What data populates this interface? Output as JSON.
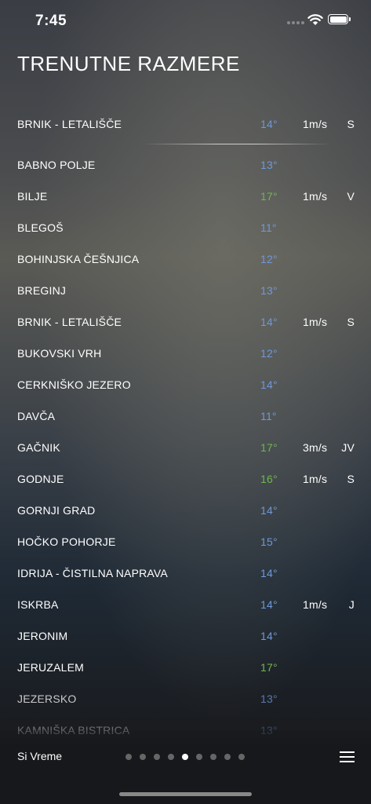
{
  "status": {
    "time": "7:45"
  },
  "title": "TRENUTNE RAZMERE",
  "featured": {
    "name": "BRNIK - LETALIŠČE",
    "temp": "14°",
    "wind": "1m/s",
    "dir": "S",
    "color": "blue"
  },
  "stations": [
    {
      "name": "BABNO POLJE",
      "temp": "13°",
      "wind": "",
      "dir": "",
      "color": "blue"
    },
    {
      "name": "BILJE",
      "temp": "17°",
      "wind": "1m/s",
      "dir": "V",
      "color": "green"
    },
    {
      "name": "BLEGOŠ",
      "temp": "11°",
      "wind": "",
      "dir": "",
      "color": "blue"
    },
    {
      "name": "BOHINJSKA ČEŠNJICA",
      "temp": "12°",
      "wind": "",
      "dir": "",
      "color": "blue"
    },
    {
      "name": "BREGINJ",
      "temp": "13°",
      "wind": "",
      "dir": "",
      "color": "blue"
    },
    {
      "name": "BRNIK - LETALIŠČE",
      "temp": "14°",
      "wind": "1m/s",
      "dir": "S",
      "color": "blue"
    },
    {
      "name": "BUKOVSKI VRH",
      "temp": "12°",
      "wind": "",
      "dir": "",
      "color": "blue"
    },
    {
      "name": "CERKNIŠKO JEZERO",
      "temp": "14°",
      "wind": "",
      "dir": "",
      "color": "blue"
    },
    {
      "name": "DAVČA",
      "temp": "11°",
      "wind": "",
      "dir": "",
      "color": "blue"
    },
    {
      "name": "GAČNIK",
      "temp": "17°",
      "wind": "3m/s",
      "dir": "JV",
      "color": "green"
    },
    {
      "name": "GODNJE",
      "temp": "16°",
      "wind": "1m/s",
      "dir": "S",
      "color": "green"
    },
    {
      "name": "GORNJI GRAD",
      "temp": "14°",
      "wind": "",
      "dir": "",
      "color": "blue"
    },
    {
      "name": "HOČKO POHORJE",
      "temp": "15°",
      "wind": "",
      "dir": "",
      "color": "blue"
    },
    {
      "name": "IDRIJA - ČISTILNA NAPRAVA",
      "temp": "14°",
      "wind": "",
      "dir": "",
      "color": "blue"
    },
    {
      "name": "ISKRBA",
      "temp": "14°",
      "wind": "1m/s",
      "dir": "J",
      "color": "blue"
    },
    {
      "name": "JERONIM",
      "temp": "14°",
      "wind": "",
      "dir": "",
      "color": "blue"
    },
    {
      "name": "JERUZALEM",
      "temp": "17°",
      "wind": "",
      "dir": "",
      "color": "green"
    },
    {
      "name": "JEZERSKO",
      "temp": "13°",
      "wind": "",
      "dir": "",
      "color": "blue"
    },
    {
      "name": "KAMNIŠKA BISTRICA",
      "temp": "13°",
      "wind": "",
      "dir": "",
      "color": "blue"
    }
  ],
  "footer": {
    "brand": "Si Vreme",
    "page_count": 9,
    "active_page": 4
  },
  "colors": {
    "blue": "#6f98d8",
    "green": "#6fb64e"
  },
  "icons": {
    "wifi": "wifi-icon",
    "battery": "battery-icon",
    "menu": "hamburger-menu-icon"
  }
}
